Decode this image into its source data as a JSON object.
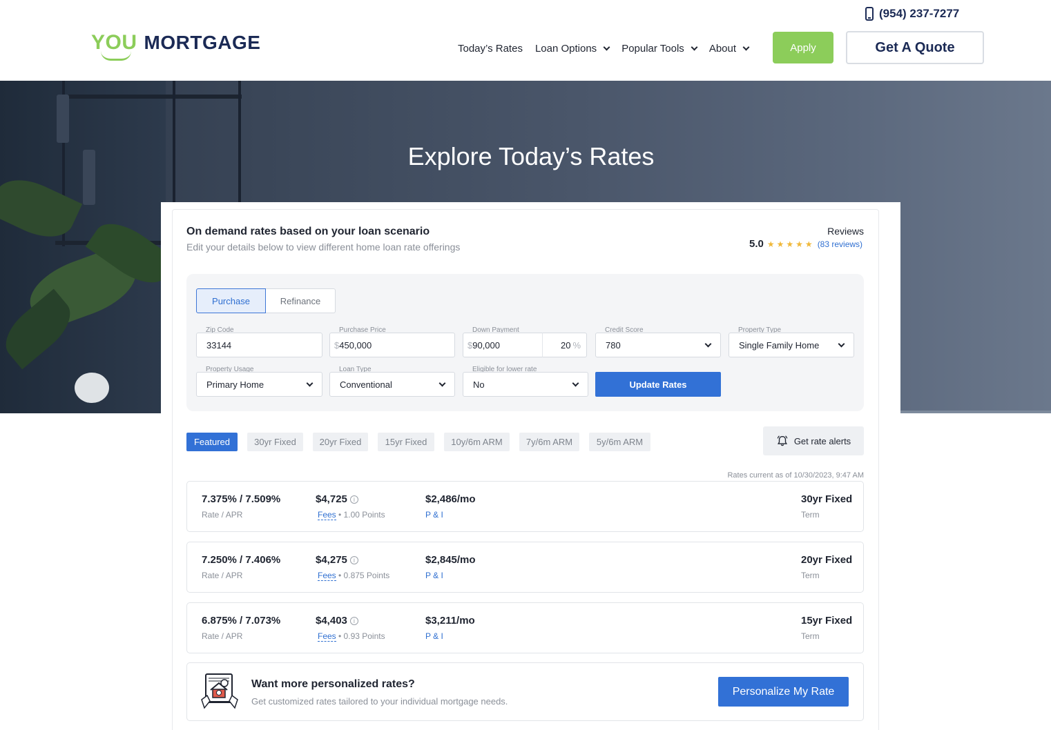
{
  "header": {
    "logo_you": "YOU",
    "logo_mortgage": "MORTGAGE",
    "phone": "(954) 237-7277",
    "nav": [
      "Today’s Rates",
      "Loan Options",
      "Popular Tools",
      "About"
    ],
    "apply_label": "Apply",
    "quote_label": "Get A Quote"
  },
  "hero": {
    "title": "Explore Today’s Rates"
  },
  "card": {
    "title": "On demand rates based on your loan scenario",
    "subtitle": "Edit your details below to view different home loan rate offerings",
    "reviews_label": "Reviews",
    "score": "5.0",
    "stars": 5,
    "reviews_count": "(83 reviews)"
  },
  "form": {
    "segments": [
      "Purchase",
      "Refinance"
    ],
    "zip_label": "Zip Code",
    "zip_value": "33144",
    "price_label": "Purchase Price",
    "price_prefix": "$",
    "price_value": "450,000",
    "down_label": "Down Payment",
    "down_prefix": "$",
    "down_value": "90,000",
    "down_pct": "20",
    "pct_symbol": "%",
    "credit_label": "Credit Score",
    "credit_value": "780",
    "ptype_label": "Property Type",
    "ptype_value": "Single Family Home",
    "usage_label": "Property Usage",
    "usage_value": "Primary Home",
    "loan_label": "Loan Type",
    "loan_value": "Conventional",
    "eligible_label": "Eligible for lower rate",
    "eligible_value": "No",
    "update_label": "Update Rates"
  },
  "tabs": [
    "Featured",
    "30yr Fixed",
    "20yr Fixed",
    "15yr Fixed",
    "10y/6m ARM",
    "7y/6m ARM",
    "5y/6m ARM"
  ],
  "alerts_label": "Get rate alerts",
  "rates_current": "Rates current as of 10/30/2023, 9:47 AM",
  "rates": [
    {
      "rate": "7.375% / 7.509%",
      "rate_sub": "Rate / APR",
      "cost": "$4,725",
      "fees": "Fees",
      "points": " • 1.00 Points",
      "payment": "$2,486/mo",
      "pi": "P & I",
      "term": "30yr Fixed",
      "term_sub": "Term"
    },
    {
      "rate": "7.250% / 7.406%",
      "rate_sub": "Rate / APR",
      "cost": "$4,275",
      "fees": "Fees",
      "points": " • 0.875 Points",
      "payment": "$2,845/mo",
      "pi": "P & I",
      "term": "20yr Fixed",
      "term_sub": "Term"
    },
    {
      "rate": "6.875% / 7.073%",
      "rate_sub": "Rate / APR",
      "cost": "$4,403",
      "fees": "Fees",
      "points": " • 0.93 Points",
      "payment": "$3,211/mo",
      "pi": "P & I",
      "term": "15yr Fixed",
      "term_sub": "Term"
    }
  ],
  "personalize": {
    "title": "Want more personalized rates?",
    "subtitle": "Get customized rates tailored to your individual mortgage needs.",
    "button": "Personalize My Rate"
  },
  "colors": {
    "brand_green": "#8ccd5a",
    "brand_navy": "#1b2a55",
    "accent_blue": "#3271d6",
    "star": "#f0b83a"
  },
  "icons": [
    "phone-icon",
    "chevron-down-icon",
    "star-icon",
    "info-icon",
    "bell-icon",
    "house-certificate-icon"
  ]
}
